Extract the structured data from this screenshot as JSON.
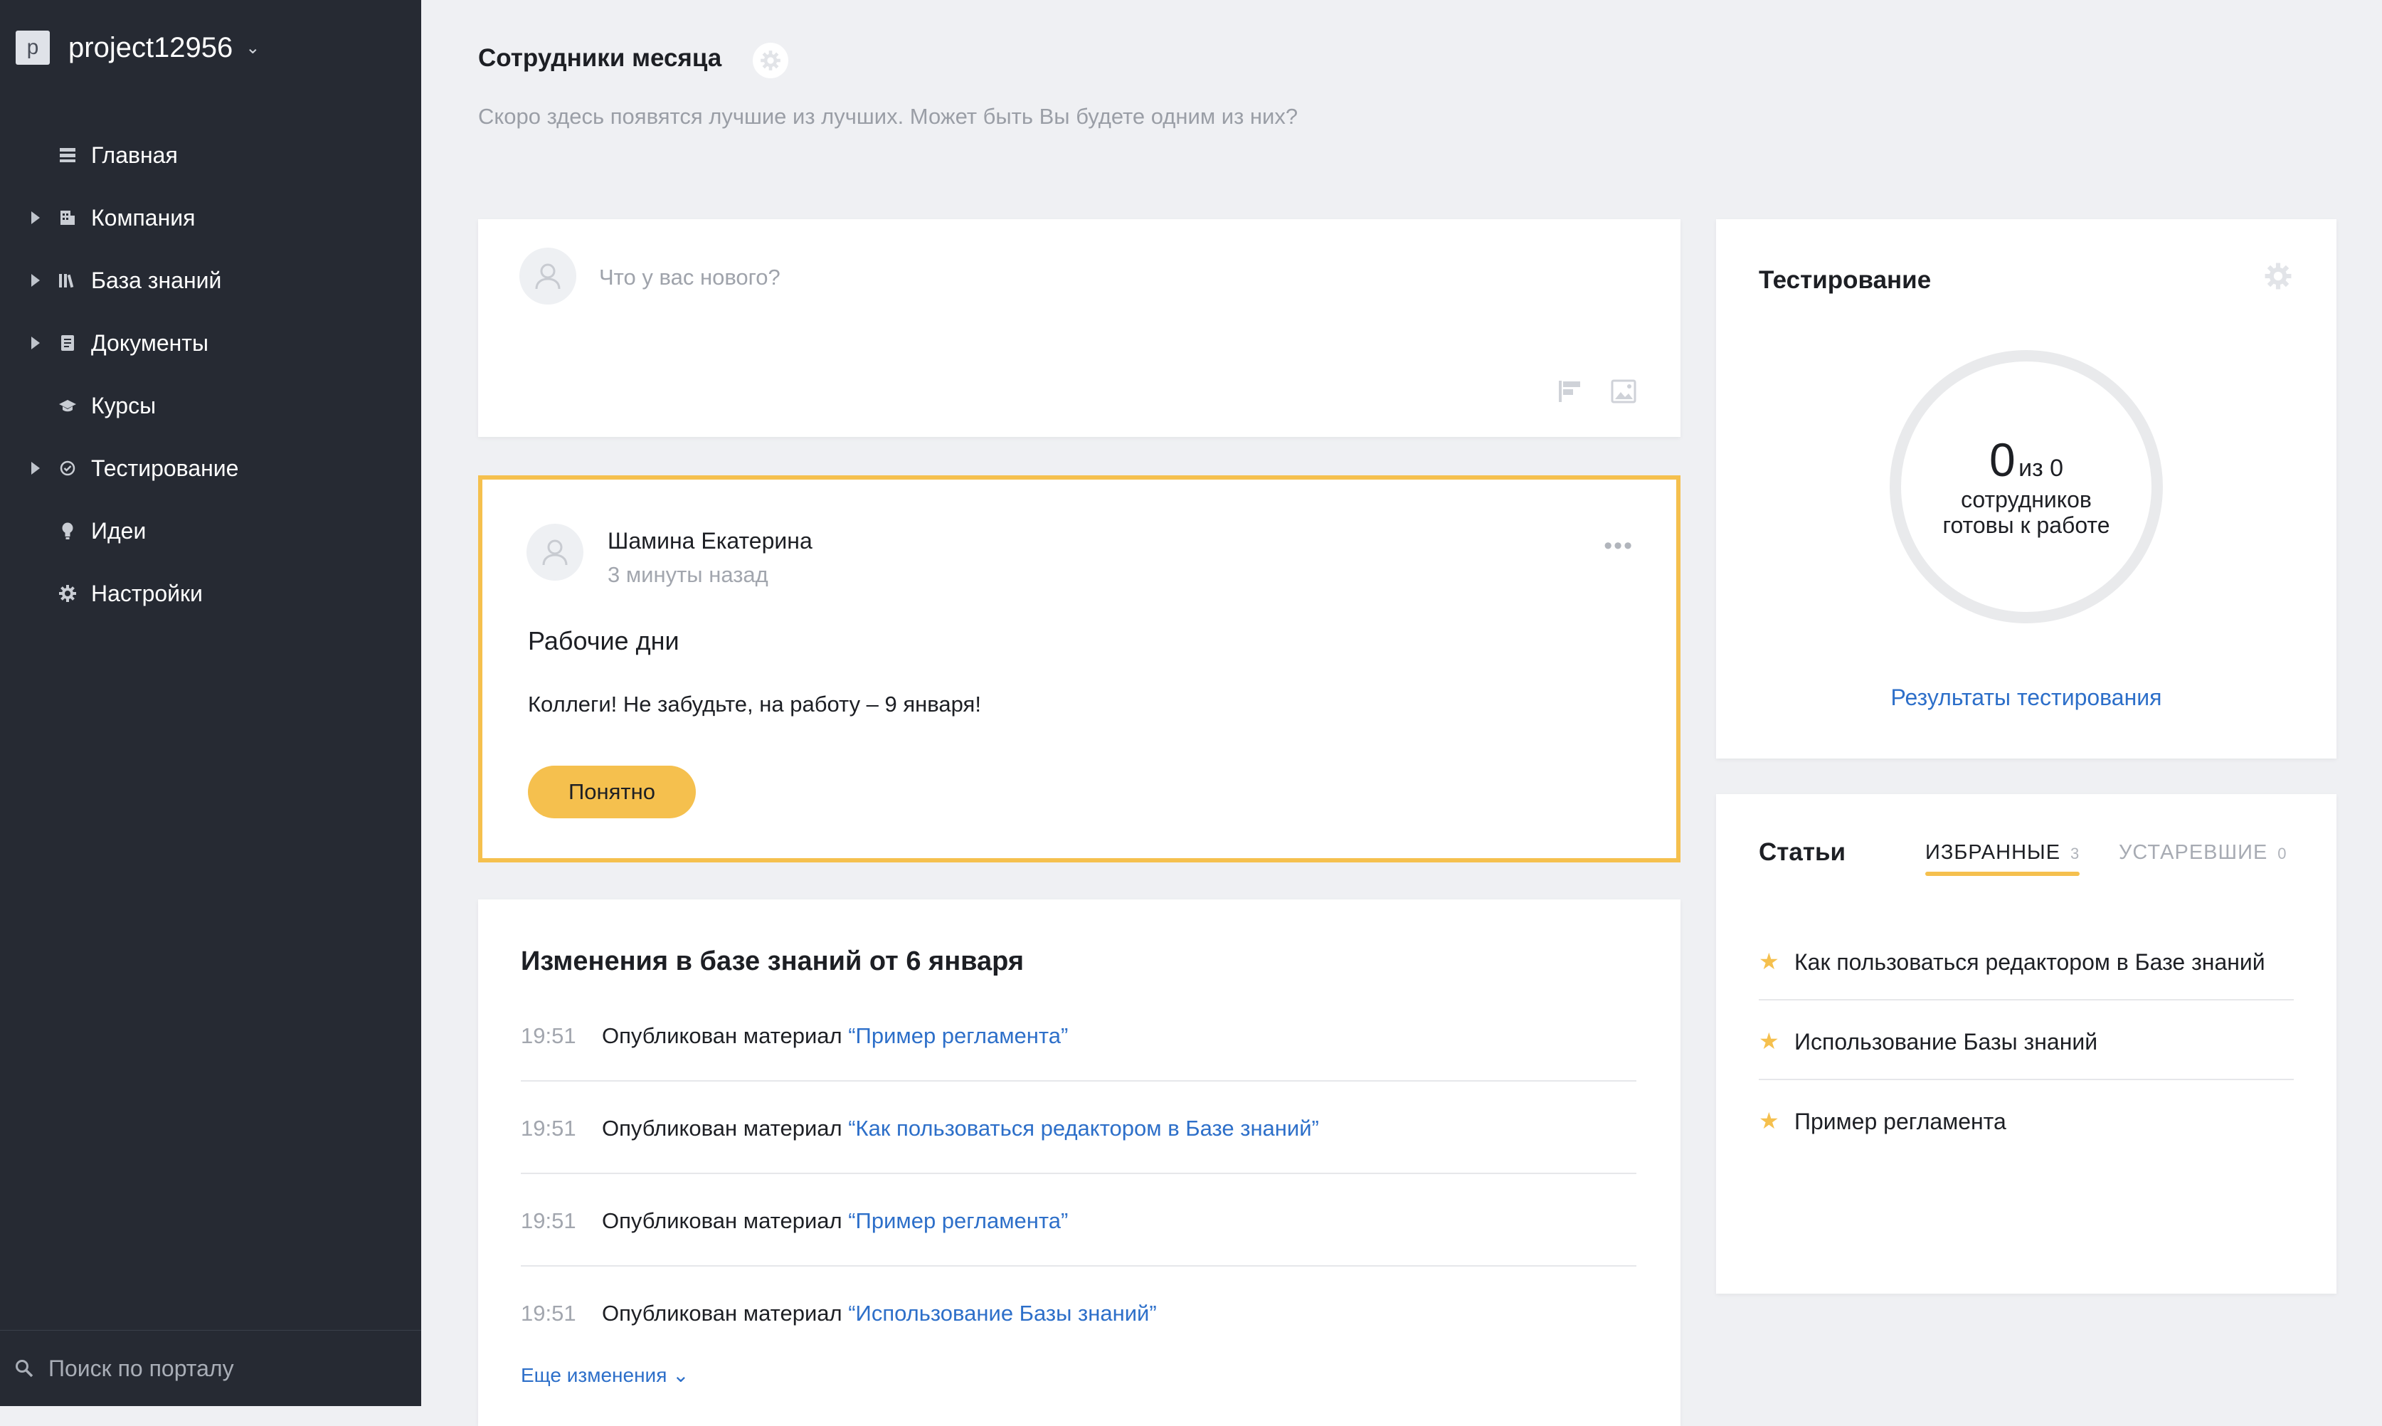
{
  "sidebar": {
    "project_logo": "p",
    "project_name": "project12956",
    "items": [
      {
        "label": "Главная",
        "icon": "list-icon",
        "expandable": false
      },
      {
        "label": "Компания",
        "icon": "building-icon",
        "expandable": true
      },
      {
        "label": "База знаний",
        "icon": "books-icon",
        "expandable": true
      },
      {
        "label": "Документы",
        "icon": "document-icon",
        "expandable": true
      },
      {
        "label": "Курсы",
        "icon": "graduation-cap-icon",
        "expandable": false
      },
      {
        "label": "Тестирование",
        "icon": "check-circle-icon",
        "expandable": true
      },
      {
        "label": "Идеи",
        "icon": "lightbulb-icon",
        "expandable": false
      },
      {
        "label": "Настройки",
        "icon": "gear-icon",
        "expandable": false
      }
    ],
    "search_placeholder": "Поиск по порталу"
  },
  "month": {
    "title": "Сотрудники месяца",
    "subtitle": "Скоро здесь появятся лучшие из лучших. Может быть Вы будете одним из них?"
  },
  "composer": {
    "placeholder": "Что у вас нового?"
  },
  "announcement": {
    "author": "Шамина Екатерина",
    "time": "3 минуты назад",
    "title": "Рабочие дни",
    "text": "Коллеги! Не забудьте, на работу – 9 января!",
    "button": "Понятно"
  },
  "changes": {
    "title": "Изменения в базе знаний от 6 января",
    "action": "Опубликован материал",
    "rows": [
      {
        "time": "19:51",
        "link": "“Пример регламента”"
      },
      {
        "time": "19:51",
        "link": "“Как пользоваться редактором в Базе знаний”"
      },
      {
        "time": "19:51",
        "link": "“Пример регламента”"
      },
      {
        "time": "19:51",
        "link": "“Использование Базы знаний”"
      }
    ],
    "more": "Еще изменения"
  },
  "testing": {
    "title": "Тестирование",
    "count": "0",
    "of": "из 0",
    "label_line1": "сотрудников",
    "label_line2": "готовы к работе",
    "results_link": "Результаты тестирования",
    "ready_fraction": 0
  },
  "articles": {
    "title": "Статьи",
    "tabs": [
      {
        "label": "ИЗБРАННЫЕ",
        "count": "3",
        "active": true
      },
      {
        "label": "УСТАРЕВШИЕ",
        "count": "0",
        "active": false
      }
    ],
    "items": [
      {
        "title": "Как пользоваться редактором в Базе знаний"
      },
      {
        "title": "Использование Базы знаний"
      },
      {
        "title": "Пример регламента"
      }
    ]
  },
  "colors": {
    "sidebar_bg": "#262a33",
    "accent_yellow": "#f5c04e",
    "link_blue": "#2d6fc9",
    "page_bg": "#eff0f3"
  }
}
